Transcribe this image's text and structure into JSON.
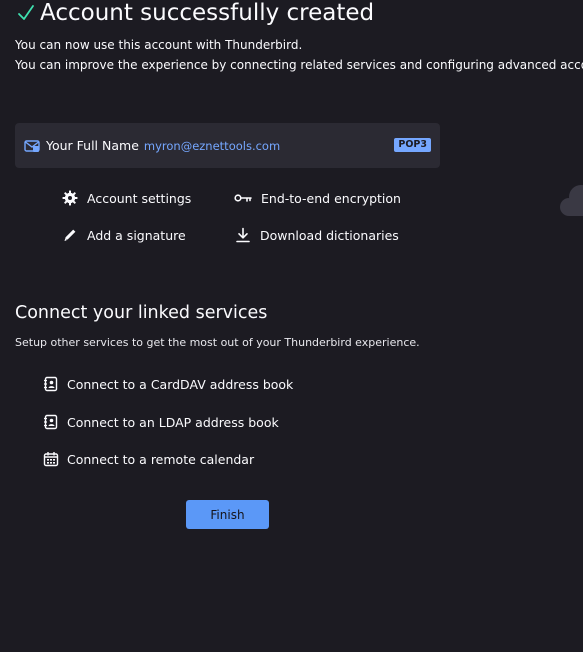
{
  "header": {
    "title": "Account successfully created",
    "line1": "You can now use this account with Thunderbird.",
    "line2": "You can improve the experience by connecting related services and configuring advanced account"
  },
  "account": {
    "name": "Your Full Name",
    "email": "myron@eznettools.com",
    "protocol": "POP3"
  },
  "actions": {
    "settings": "Account settings",
    "e2e": "End-to-end encryption",
    "signature": "Add a signature",
    "dictionaries": "Download dictionaries"
  },
  "linked": {
    "heading": "Connect your linked services",
    "subtitle": "Setup other services to get the most out of your Thunderbird experience.",
    "items": [
      "Connect to a CardDAV address book",
      "Connect to an LDAP address book",
      "Connect to a remote calendar"
    ]
  },
  "footer": {
    "finish_label": "Finish"
  },
  "colors": {
    "background": "#1c1b22",
    "card": "#2b2a33",
    "accent": "#75a7ff",
    "button": "#5b98f7",
    "check": "#3fe1b0"
  }
}
